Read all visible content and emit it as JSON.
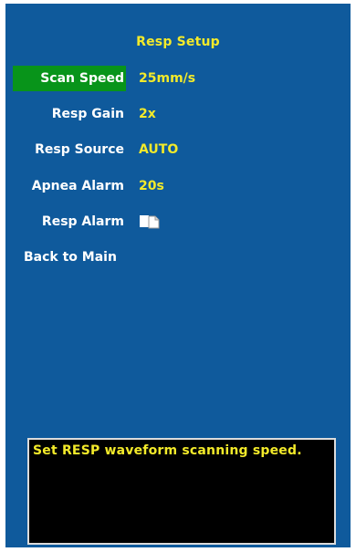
{
  "menu": {
    "title": "Resp Setup",
    "items": [
      {
        "label": "Scan Speed",
        "value": "25mm/s",
        "selected": true
      },
      {
        "label": "Resp Gain",
        "value": "2x"
      },
      {
        "label": "Resp Source",
        "value": "AUTO"
      },
      {
        "label": "Apnea Alarm",
        "value": "20s"
      },
      {
        "label": "Resp Alarm",
        "value_icon": "alarm-off-icon"
      },
      {
        "label": "Back to Main"
      }
    ]
  },
  "help": {
    "text": "Set RESP waveform scanning speed."
  },
  "colors": {
    "background": "#0f5a9c",
    "selected": "#08941a",
    "value": "#f3ea2a",
    "label": "#ffffff",
    "help_bg": "#000000"
  }
}
